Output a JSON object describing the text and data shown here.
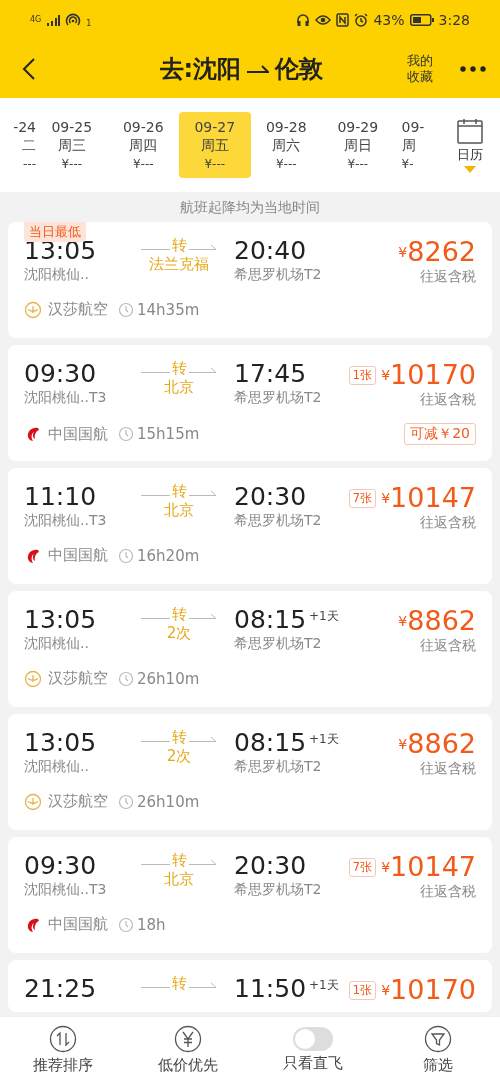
{
  "status_bar": {
    "network": "4G",
    "hotspot_count": "1",
    "battery_text": "43%",
    "time": "3:28"
  },
  "header": {
    "origin": "去:沈阳",
    "destination": "伦敦",
    "favorites": "我的收藏"
  },
  "dates": [
    {
      "date": "-24",
      "day": "二",
      "price": "---",
      "selected": false
    },
    {
      "date": "09-25",
      "day": "周三",
      "price": "¥---",
      "selected": false
    },
    {
      "date": "09-26",
      "day": "周四",
      "price": "¥---",
      "selected": false
    },
    {
      "date": "09-27",
      "day": "周五",
      "price": "¥---",
      "selected": true
    },
    {
      "date": "09-28",
      "day": "周六",
      "price": "¥---",
      "selected": false
    },
    {
      "date": "09-29",
      "day": "周日",
      "price": "¥---",
      "selected": false
    },
    {
      "date": "09-",
      "day": "周",
      "price": "¥-",
      "selected": false
    }
  ],
  "calendar_label": "日历",
  "notice": "航班起降均为当地时间",
  "flights": [
    {
      "badge": "当日最低",
      "dep_time": "13:05",
      "dep_airport": "沈阳桃仙..",
      "transfer": "转",
      "via": "法兰克福",
      "arr_time": "20:40",
      "arr_airport": "希思罗机场T2",
      "currency": "¥",
      "price": "8262",
      "price_note": "往返含税",
      "airline": {
        "kind": "ring",
        "name": "汉莎航空"
      },
      "duration": "14h35m"
    },
    {
      "dep_time": "09:30",
      "dep_airport": "沈阳桃仙..T3",
      "transfer": "转",
      "via": "北京",
      "arr_time": "17:45",
      "arr_airport": "希思罗机场T2",
      "seats": "1张",
      "currency": "¥",
      "price": "10170",
      "price_note": "往返含税",
      "airline": {
        "kind": "bird",
        "name": "中国国航"
      },
      "duration": "15h15m",
      "discount": "可减￥20"
    },
    {
      "dep_time": "11:10",
      "dep_airport": "沈阳桃仙..T3",
      "transfer": "转",
      "via": "北京",
      "arr_time": "20:30",
      "arr_airport": "希思罗机场T2",
      "seats": "7张",
      "currency": "¥",
      "price": "10147",
      "price_note": "往返含税",
      "airline": {
        "kind": "bird",
        "name": "中国国航"
      },
      "duration": "16h20m"
    },
    {
      "dep_time": "13:05",
      "dep_airport": "沈阳桃仙..",
      "transfer": "转",
      "via": "2次",
      "arr_time": "08:15",
      "next_day": "+1天",
      "arr_airport": "希思罗机场T2",
      "currency": "¥",
      "price": "8862",
      "price_note": "往返含税",
      "airline": {
        "kind": "ring",
        "name": "汉莎航空"
      },
      "duration": "26h10m"
    },
    {
      "dep_time": "13:05",
      "dep_airport": "沈阳桃仙..",
      "transfer": "转",
      "via": "2次",
      "arr_time": "08:15",
      "next_day": "+1天",
      "arr_airport": "希思罗机场T2",
      "currency": "¥",
      "price": "8862",
      "price_note": "往返含税",
      "airline": {
        "kind": "ring",
        "name": "汉莎航空"
      },
      "duration": "26h10m"
    },
    {
      "dep_time": "09:30",
      "dep_airport": "沈阳桃仙..T3",
      "transfer": "转",
      "via": "北京",
      "arr_time": "20:30",
      "arr_airport": "希思罗机场T2",
      "seats": "7张",
      "currency": "¥",
      "price": "10147",
      "price_note": "往返含税",
      "airline": {
        "kind": "bird",
        "name": "中国国航"
      },
      "duration": "18h"
    },
    {
      "dep_time": "21:25",
      "transfer": "转",
      "arr_time": "11:50",
      "next_day": "+1天",
      "seats": "1张",
      "currency": "¥",
      "price": "10170"
    }
  ],
  "bottom_bar": [
    {
      "kind": "sort",
      "label": "推荐排序"
    },
    {
      "kind": "price",
      "label": "低价优先"
    },
    {
      "kind": "toggle",
      "label": "只看直飞",
      "on": false
    },
    {
      "kind": "filter",
      "label": "筛选"
    }
  ]
}
